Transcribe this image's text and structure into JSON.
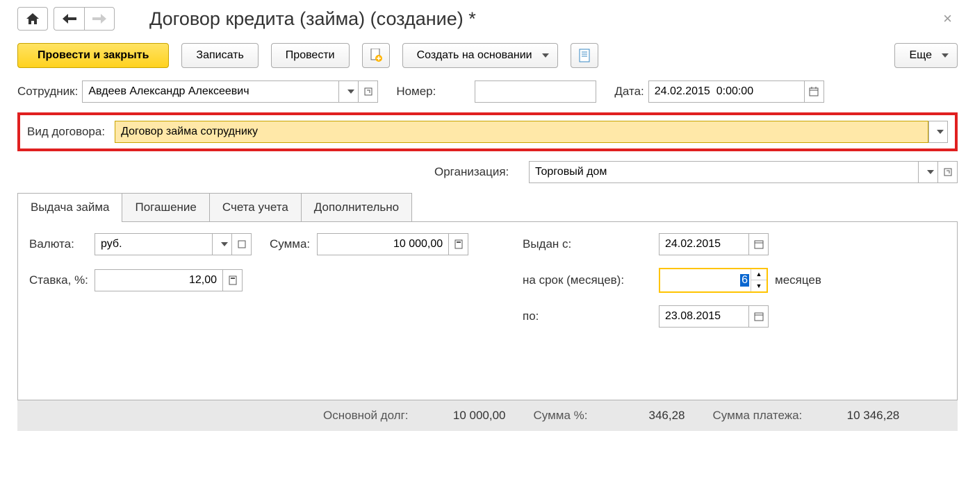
{
  "title": "Договор кредита (займа) (создание) *",
  "toolbar": {
    "post_close": "Провести и закрыть",
    "save": "Записать",
    "post": "Провести",
    "create_based": "Создать на основании",
    "more": "Еще"
  },
  "fields": {
    "employee_label": "Сотрудник:",
    "employee_value": "Авдеев Александр Алексеевич",
    "number_label": "Номер:",
    "number_value": "",
    "date_label": "Дата:",
    "date_value": "24.02.2015  0:00:00",
    "contract_type_label": "Вид договора:",
    "contract_type_value": "Договор займа сотруднику",
    "org_label": "Организация:",
    "org_value": "Торговый дом"
  },
  "tabs": {
    "issue": "Выдача займа",
    "repay": "Погашение",
    "accounts": "Счета учета",
    "additional": "Дополнительно"
  },
  "issue": {
    "currency_label": "Валюта:",
    "currency_value": "руб.",
    "amount_label": "Сумма:",
    "amount_value": "10 000,00",
    "rate_label": "Ставка, %:",
    "rate_value": "12,00",
    "issued_from_label": "Выдан с:",
    "issued_from_value": "24.02.2015",
    "term_label": "на срок (месяцев):",
    "term_value": "6",
    "term_suffix": "месяцев",
    "to_label": "по:",
    "to_value": "23.08.2015"
  },
  "footer": {
    "principal_label": "Основной долг:",
    "principal_value": "10 000,00",
    "percent_label": "Сумма %:",
    "percent_value": "346,28",
    "payment_label": "Сумма платежа:",
    "payment_value": "10 346,28"
  }
}
